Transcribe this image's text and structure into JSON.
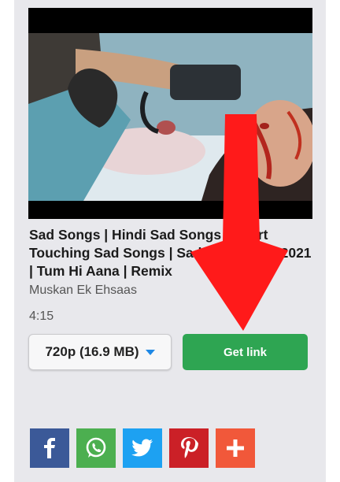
{
  "video": {
    "title": "Sad Songs | Hindi Sad Songs | Heart Touching Sad Songs | Sad Love Story 2021 | Tum Hi Aana | Remix",
    "channel": "Muskan Ek Ehsaas",
    "duration": "4:15"
  },
  "download": {
    "quality_selected": "720p (16.9 MB)",
    "get_link_label": "Get link"
  },
  "share": {
    "buttons": [
      {
        "icon": "facebook-icon",
        "color": "#3b5998"
      },
      {
        "icon": "whatsapp-icon",
        "color": "#4caf50"
      },
      {
        "icon": "twitter-icon",
        "color": "#1da1f2"
      },
      {
        "icon": "pinterest-icon",
        "color": "#cb2027"
      },
      {
        "icon": "plus-icon",
        "color": "#f1583a"
      }
    ]
  },
  "annotation": {
    "arrow_color": "#ff1a1a"
  }
}
